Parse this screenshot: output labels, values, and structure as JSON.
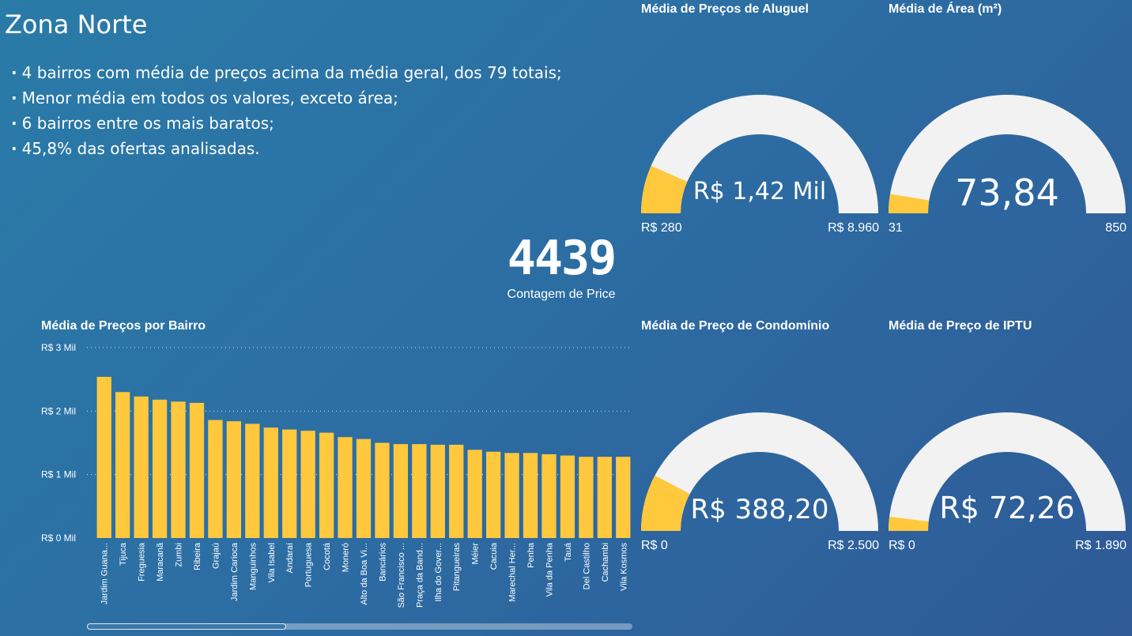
{
  "header": {
    "title": "Zona Norte",
    "bullets": [
      "4 bairros com média de preços acima da média geral, dos 79 totais;",
      "Menor média em todos os valores, exceto área;",
      "6 bairros entre os mais baratos;",
      "45,8% das ofertas analisadas."
    ]
  },
  "kpi": {
    "value": "4439",
    "label": "Contagem de Price"
  },
  "colors": {
    "bar": "#ffc83d",
    "gauge_fill": "#ffc83d",
    "gauge_track": "#f3f2f2",
    "grid": "#d8e6f0"
  },
  "chart_data": [
    {
      "type": "bar",
      "title": "Média de Preços por Bairro",
      "categories": [
        "Jardim Guana...",
        "Tijuca",
        "Freguesia",
        "Maracanã",
        "Zumbi",
        "Ribeira",
        "Grajaú",
        "Jardim Carioca",
        "Manguinhos",
        "Vila Isabel",
        "Andaraí",
        "Portuguesa",
        "Cocotá",
        "Moneró",
        "Alto da Boa Vi...",
        "Bancários",
        "São Francisco ...",
        "Praça da Band...",
        "Ilha do Gover...",
        "Pitangueiras",
        "Méier",
        "Cacuia",
        "Marechal Her...",
        "Penha",
        "Vila da Penha",
        "Tauá",
        "Del Castilho",
        "Cachambi",
        "Vila Kosmos"
      ],
      "values": [
        2540,
        2300,
        2230,
        2180,
        2150,
        2130,
        1860,
        1840,
        1800,
        1740,
        1710,
        1690,
        1660,
        1590,
        1560,
        1500,
        1480,
        1480,
        1470,
        1470,
        1390,
        1360,
        1340,
        1340,
        1320,
        1300,
        1280,
        1280,
        1280
      ],
      "ylim": [
        0,
        3000
      ],
      "yticks": [
        {
          "value": 0,
          "label": "R$ 0 Mil"
        },
        {
          "value": 1000,
          "label": "R$ 1 Mil"
        },
        {
          "value": 2000,
          "label": "R$ 2 Mil"
        },
        {
          "value": 3000,
          "label": "R$ 3 Mil"
        }
      ],
      "grid": true
    },
    {
      "type": "gauge",
      "title": "Média de Preços de Aluguel",
      "value": 1420,
      "min": 280,
      "max": 8960,
      "value_label": "R$ 1,42 Mil",
      "min_label": "R$ 280",
      "max_label": "R$ 8.960"
    },
    {
      "type": "gauge",
      "title": "Média de Área (m²)",
      "value": 73.84,
      "min": 31,
      "max": 850,
      "value_label": "73,84",
      "min_label": "31",
      "max_label": "850"
    },
    {
      "type": "gauge",
      "title": "Média de Preço de Condomínio",
      "value": 388.2,
      "min": 0,
      "max": 2500,
      "value_label": "R$ 388,20",
      "min_label": "R$ 0",
      "max_label": "R$ 2.500"
    },
    {
      "type": "gauge",
      "title": "Média de Preço de IPTU",
      "value": 72.26,
      "min": 0,
      "max": 1890,
      "value_label": "R$ 72,26",
      "min_label": "R$ 0",
      "max_label": "R$ 1.890"
    }
  ]
}
